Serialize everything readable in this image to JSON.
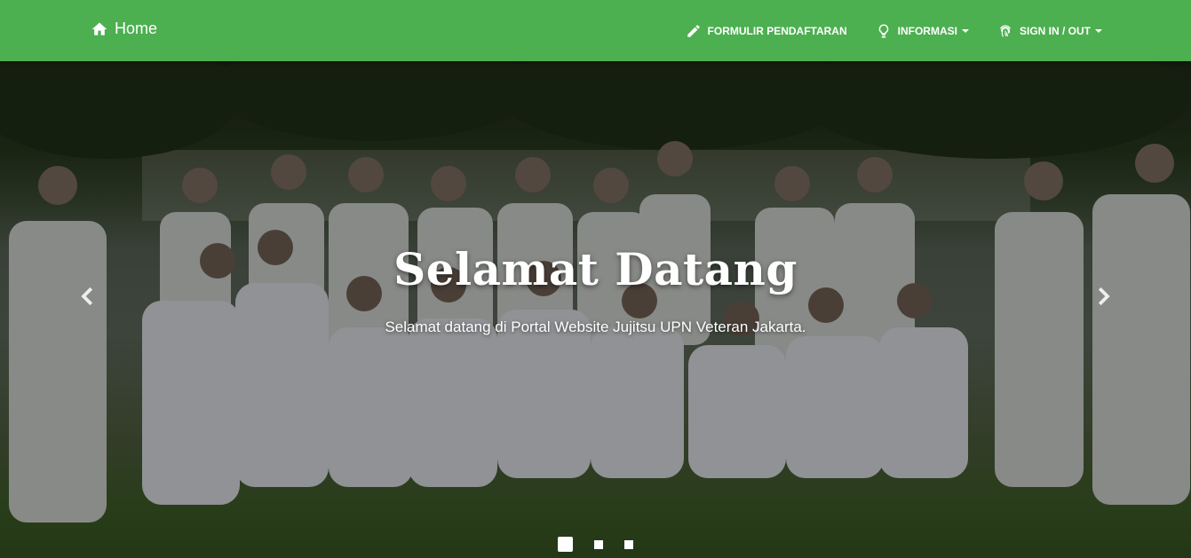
{
  "navbar": {
    "brand_label": "Home",
    "brand_icon": "home-icon",
    "items": [
      {
        "label": "FORMULIR PENDAFTARAN",
        "icon": "pencil-icon",
        "dropdown": false
      },
      {
        "label": "INFORMASI",
        "icon": "lightbulb-icon",
        "dropdown": true
      },
      {
        "label": "SIGN IN / OUT",
        "icon": "fingerprint-icon",
        "dropdown": true
      }
    ],
    "color": "#4caf50"
  },
  "hero": {
    "title": "Selamat Datang",
    "subtitle": "Selamat datang di Portal Website Jujitsu UPN Veteran Jakarta.",
    "slide_count": 3,
    "active_slide": 1
  }
}
